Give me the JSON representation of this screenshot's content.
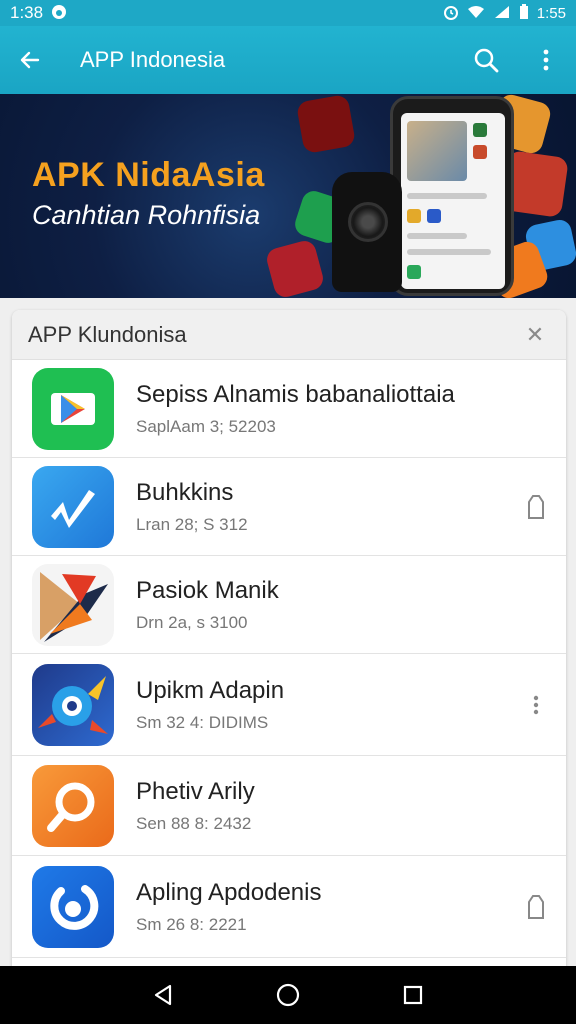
{
  "status_bar": {
    "time": "1:38",
    "right_text": "1:55",
    "icons": [
      "alarm-icon",
      "wifi-icon",
      "battery-icon"
    ]
  },
  "app_bar": {
    "title": "APP Indonesia",
    "icons": [
      "back-arrow-icon",
      "search-icon",
      "more-vert-icon"
    ]
  },
  "banner": {
    "title": "APK NidaAsia",
    "subtitle": "Canhtian Rohnfisia"
  },
  "card": {
    "title": "APP Klundonisa",
    "items": [
      {
        "name": "Sepiss Alnamis babanaliottaia",
        "meta": "SaplAam 3; 52203",
        "icon": "play-store-icon",
        "action": ""
      },
      {
        "name": "Buhkkins",
        "meta": "Lran 28; S 312",
        "icon": "music-note-icon",
        "action": "bookmark-icon"
      },
      {
        "name": "Pasiok Manik",
        "meta": "Drn 2a, s 3100",
        "icon": "arrow-logo-icon",
        "action": ""
      },
      {
        "name": "Upikm Adapin",
        "meta": "Sm 32 4: DIDIMS",
        "icon": "game-icon",
        "action": "more-vert-icon"
      },
      {
        "name": "Phetiv Arily",
        "meta": "Sen 88 8: 2432",
        "icon": "search-logo-icon",
        "action": ""
      },
      {
        "name": "Apling Apdodenis",
        "meta": "Sm 26 8: 2221",
        "icon": "ring-logo-icon",
        "action": "bookmark-icon"
      }
    ]
  },
  "colors": {
    "app_bar": "#1aa5c4",
    "banner_title": "#f5a11f",
    "banner_bg": "#0e1f44"
  }
}
